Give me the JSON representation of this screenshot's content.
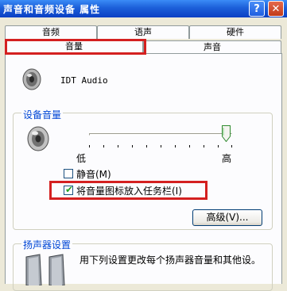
{
  "window": {
    "title": "声音和音频设备 属性",
    "help_glyph": "?",
    "close_glyph": "✕"
  },
  "tabs": {
    "row_top": [
      "音频",
      "语声",
      "硬件"
    ],
    "row_bottom": [
      "音量",
      "声音"
    ],
    "selected": "音量"
  },
  "device": {
    "name": "IDT Audio",
    "icon": "speaker-icon"
  },
  "device_volume": {
    "legend": "设备音量",
    "low_label": "低",
    "high_label": "高",
    "level_fraction": 1.0,
    "mute_label": "静音(M)",
    "mute_checked": false,
    "taskbar_label": "将音量图标放入任务栏(I)",
    "taskbar_checked": true,
    "advanced_label": "高级(V)..."
  },
  "speaker_settings": {
    "legend": "扬声器设置",
    "description": "用下列设置更改每个扬声器音量和其他设。"
  },
  "colors": {
    "highlight": "#d42020",
    "titlebar": "#1c5fd9",
    "group_legend": "#0046d5"
  }
}
